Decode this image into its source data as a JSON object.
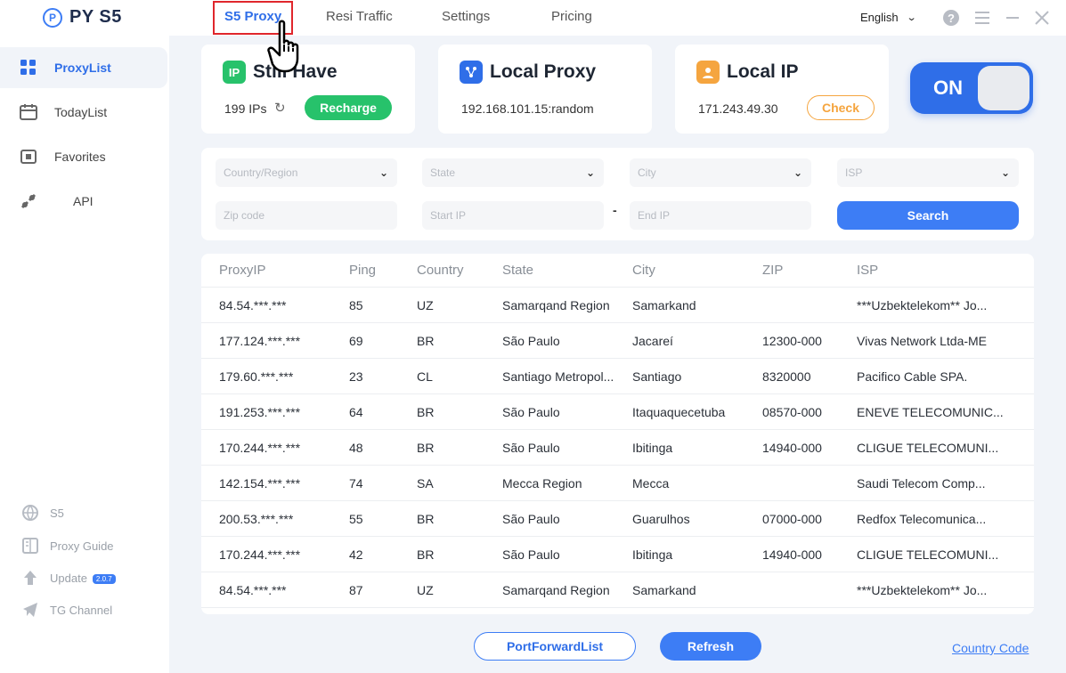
{
  "app": {
    "name": "PY S5"
  },
  "tabs": [
    {
      "label": "S5 Proxy",
      "active": true
    },
    {
      "label": "Resi Traffic"
    },
    {
      "label": "Settings"
    },
    {
      "label": "Pricing"
    }
  ],
  "header": {
    "language": "English"
  },
  "sidebar": {
    "items": [
      {
        "label": "ProxyList",
        "active": true
      },
      {
        "label": "TodayList"
      },
      {
        "label": "Favorites"
      },
      {
        "label": "API"
      }
    ],
    "bottom": [
      {
        "label": "S5"
      },
      {
        "label": "Proxy Guide"
      },
      {
        "label": "Update",
        "badge": "2.0.7"
      },
      {
        "label": "TG Channel"
      }
    ]
  },
  "cards": {
    "still_have": {
      "title": "Still Have",
      "icon_text": "IP",
      "value": "199 IPs",
      "button": "Recharge"
    },
    "local_proxy": {
      "title": "Local Proxy",
      "value": "192.168.101.15:random"
    },
    "local_ip": {
      "title": "Local IP",
      "value": "171.243.49.30",
      "button": "Check"
    }
  },
  "toggle": {
    "label": "ON",
    "state": "on"
  },
  "filters": {
    "country": "Country/Region",
    "state": "State",
    "city": "City",
    "isp": "ISP",
    "zip": "Zip code",
    "start_ip": "Start IP",
    "separator": "-",
    "end_ip": "End IP",
    "search": "Search"
  },
  "table": {
    "headers": [
      "ProxyIP",
      "Ping",
      "Country",
      "State",
      "City",
      "ZIP",
      "ISP"
    ],
    "rows": [
      [
        "84.54.***.***",
        "85",
        "UZ",
        "Samarqand Region",
        "Samarkand",
        "",
        "***Uzbektelekom** Jo..."
      ],
      [
        "177.124.***.***",
        "69",
        "BR",
        "São Paulo",
        "Jacareí",
        "12300-000",
        "Vivas Network Ltda-ME"
      ],
      [
        "179.60.***.***",
        "23",
        "CL",
        "Santiago Metropol...",
        "Santiago",
        "8320000",
        "Pacifico Cable SPA."
      ],
      [
        "191.253.***.***",
        "64",
        "BR",
        "São Paulo",
        "Itaquaquecetuba",
        "08570-000",
        "ENEVE TELECOMUNIC..."
      ],
      [
        "170.244.***.***",
        "48",
        "BR",
        "São Paulo",
        "Ibitinga",
        "14940-000",
        "CLIGUE TELECOMUNI..."
      ],
      [
        "142.154.***.***",
        "74",
        "SA",
        "Mecca Region",
        "Mecca",
        "",
        "Saudi Telecom Comp..."
      ],
      [
        "200.53.***.***",
        "55",
        "BR",
        "São Paulo",
        "Guarulhos",
        "07000-000",
        "Redfox Telecomunica..."
      ],
      [
        "170.244.***.***",
        "42",
        "BR",
        "São Paulo",
        "Ibitinga",
        "14940-000",
        "CLIGUE TELECOMUNI..."
      ],
      [
        "84.54.***.***",
        "87",
        "UZ",
        "Samarqand Region",
        "Samarkand",
        "",
        "***Uzbektelekom** Jo..."
      ]
    ]
  },
  "footer": {
    "port_forward": "PortForwardList",
    "refresh": "Refresh",
    "country_code": "Country Code"
  },
  "colors": {
    "primary": "#3d7df5",
    "green": "#27c26b",
    "orange": "#f5a53f",
    "highlight": "#e0262c",
    "background": "#f1f4f9"
  }
}
